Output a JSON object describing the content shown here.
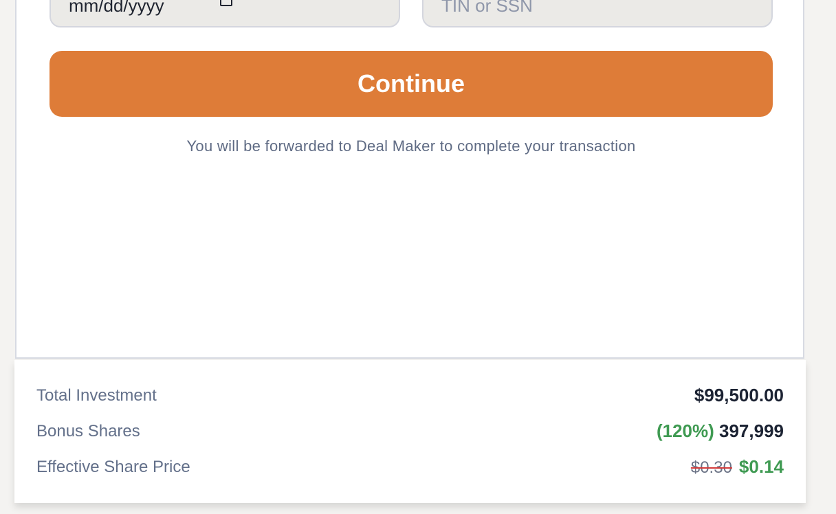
{
  "form": {
    "date_placeholder": "mm/dd/yyyy",
    "tin_placeholder": "TIN or SSN",
    "continue_label": "Continue",
    "forward_note": "You will be forwarded to Deal Maker to complete your transaction"
  },
  "summary": {
    "total_investment_label": "Total Investment",
    "total_investment_value": "$99,500.00",
    "bonus_shares_label": "Bonus Shares",
    "bonus_shares_percent": "(120%)",
    "bonus_shares_value": "397,999",
    "effective_price_label": "Effective Share Price",
    "original_price": "$0.30",
    "effective_price": "$0.14"
  },
  "colors": {
    "accent": "#de7c38",
    "positive": "#3f9a52",
    "strike": "#d43c3c"
  }
}
